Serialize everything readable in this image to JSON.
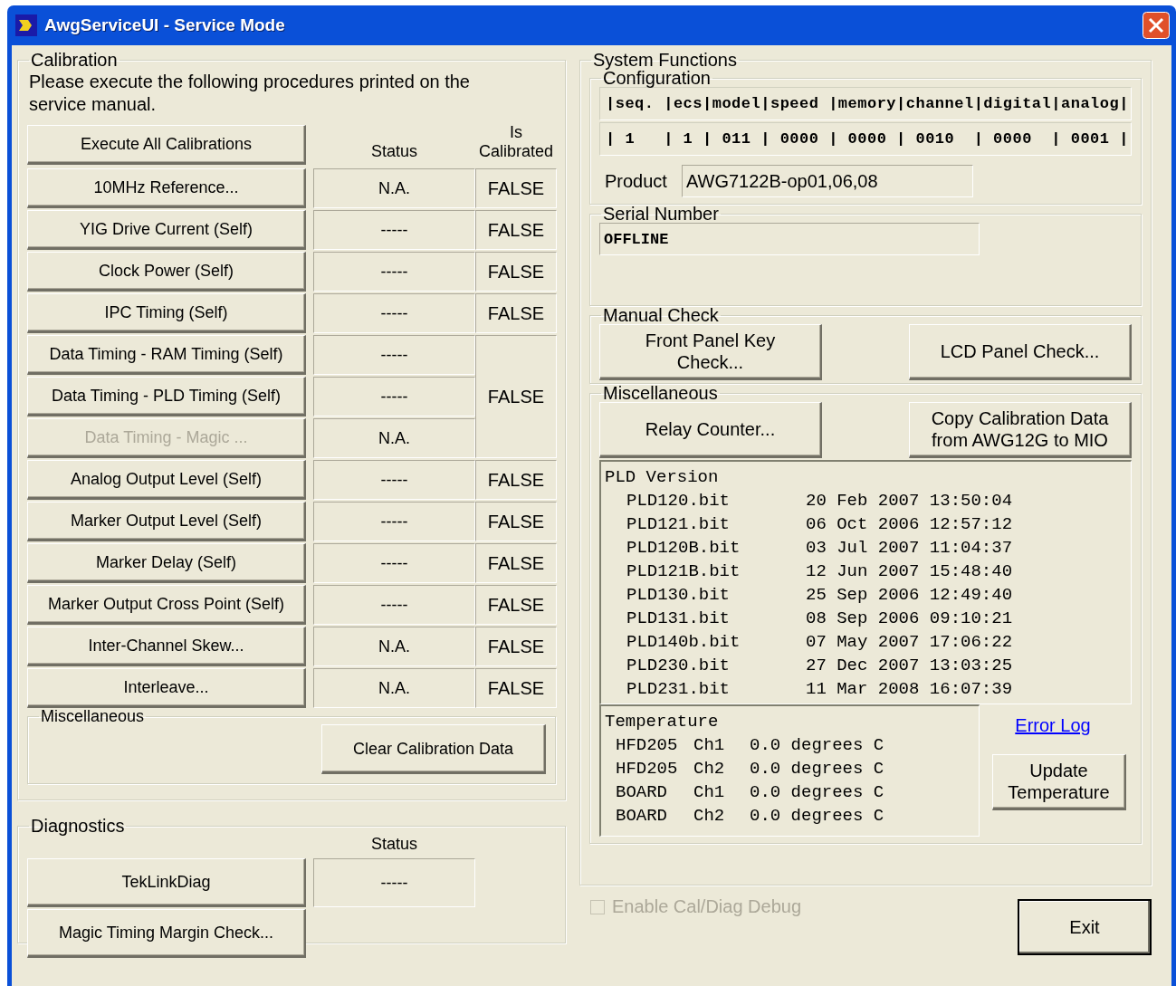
{
  "window": {
    "title": "AwgServiceUI - Service Mode"
  },
  "calibration": {
    "title": "Calibration",
    "description": "Please execute the following procedures printed on the service manual.",
    "execute_all_button": "Execute All Calibrations",
    "status_header": "Status",
    "is_calibrated_header": "Is Calibrated",
    "rows": [
      {
        "name": "10MHz Reference...",
        "status": "N.A.",
        "is_calibrated": "FALSE",
        "disabled": false
      },
      {
        "name": "YIG Drive Current (Self)",
        "status": "-----",
        "is_calibrated": "FALSE",
        "disabled": false
      },
      {
        "name": "Clock Power (Self)",
        "status": "-----",
        "is_calibrated": "FALSE",
        "disabled": false
      },
      {
        "name": "IPC Timing (Self)",
        "status": "-----",
        "is_calibrated": "FALSE",
        "disabled": false
      },
      {
        "name": "Data Timing - RAM Timing (Self)",
        "status": "-----",
        "is_calibrated": "FALSE",
        "disabled": false
      },
      {
        "name": "Data Timing - PLD Timing (Self)",
        "status": "-----",
        "disabled": false
      },
      {
        "name": "Data Timing - Magic ...",
        "status": "N.A.",
        "disabled": true
      },
      {
        "name": "Analog Output Level (Self)",
        "status": "-----",
        "is_calibrated": "FALSE",
        "disabled": false
      },
      {
        "name": "Marker Output Level (Self)",
        "status": "-----",
        "is_calibrated": "FALSE",
        "disabled": false
      },
      {
        "name": "Marker Delay (Self)",
        "status": "-----",
        "is_calibrated": "FALSE",
        "disabled": false
      },
      {
        "name": "Marker Output Cross Point (Self)",
        "status": "-----",
        "is_calibrated": "FALSE",
        "disabled": false
      },
      {
        "name": "Inter-Channel Skew...",
        "status": "N.A.",
        "is_calibrated": "FALSE",
        "disabled": false
      },
      {
        "name": "Interleave...",
        "status": "N.A.",
        "is_calibrated": "FALSE",
        "disabled": false
      }
    ],
    "miscellaneous": {
      "title": "Miscellaneous",
      "clear_button": "Clear Calibration Data"
    }
  },
  "diagnostics": {
    "title": "Diagnostics",
    "status_header": "Status",
    "items": [
      {
        "name": "TekLinkDiag",
        "status": "-----"
      },
      {
        "name": "Magic Timing Margin Check..."
      }
    ]
  },
  "system_functions": {
    "title": "System Functions",
    "configuration": {
      "title": "Configuration",
      "header": "|seq. |ecs|model|speed |memory|channel|digital|analog|",
      "values": "| 1   | 1 | 011 | 0000 | 0000 | 0010  | 0000  | 0001 |",
      "product_label": "Product",
      "product": "AWG7122B-op01,06,08"
    },
    "serial_number": {
      "title": "Serial Number",
      "value": "OFFLINE"
    },
    "manual_check": {
      "title": "Manual Check",
      "buttons": [
        "Front Panel Key Check...",
        "LCD Panel Check..."
      ]
    },
    "miscellaneous": {
      "title": "Miscellaneous",
      "buttons": [
        "Relay Counter...",
        "Copy Calibration Data from AWG12G to MIO"
      ],
      "pld_version": {
        "title": "PLD Version",
        "files": [
          {
            "file": "PLD120.bit",
            "date": "20 Feb 2007 13:50:04"
          },
          {
            "file": "PLD121.bit",
            "date": "06 Oct 2006 12:57:12"
          },
          {
            "file": "PLD120B.bit",
            "date": "03 Jul 2007 11:04:37"
          },
          {
            "file": "PLD121B.bit",
            "date": "12 Jun 2007 15:48:40"
          },
          {
            "file": "PLD130.bit",
            "date": "25 Sep 2006 12:49:40"
          },
          {
            "file": "PLD131.bit",
            "date": "08 Sep 2006 09:10:21"
          },
          {
            "file": "PLD140b.bit",
            "date": "07 May 2007 17:06:22"
          },
          {
            "file": "PLD230.bit",
            "date": "27 Dec 2007 13:03:25"
          },
          {
            "file": "PLD231.bit",
            "date": "11 Mar 2008 16:07:39"
          }
        ]
      },
      "temperature": {
        "title": "Temperature",
        "readings": [
          {
            "sensor": "HFD205",
            "channel": "Ch1",
            "value": "0.0 degrees C"
          },
          {
            "sensor": "HFD205",
            "channel": "Ch2",
            "value": "0.0 degrees C"
          },
          {
            "sensor": "BOARD",
            "channel": "Ch1",
            "value": "0.0 degrees C"
          },
          {
            "sensor": "BOARD",
            "channel": "Ch2",
            "value": "0.0 degrees C"
          }
        ]
      },
      "error_log_link": "Error Log",
      "update_temperature_button": "Update Temperature"
    }
  },
  "debug_checkbox": {
    "label": "Enable Cal/Diag Debug",
    "checked": false,
    "disabled": true
  },
  "exit_button": "Exit"
}
